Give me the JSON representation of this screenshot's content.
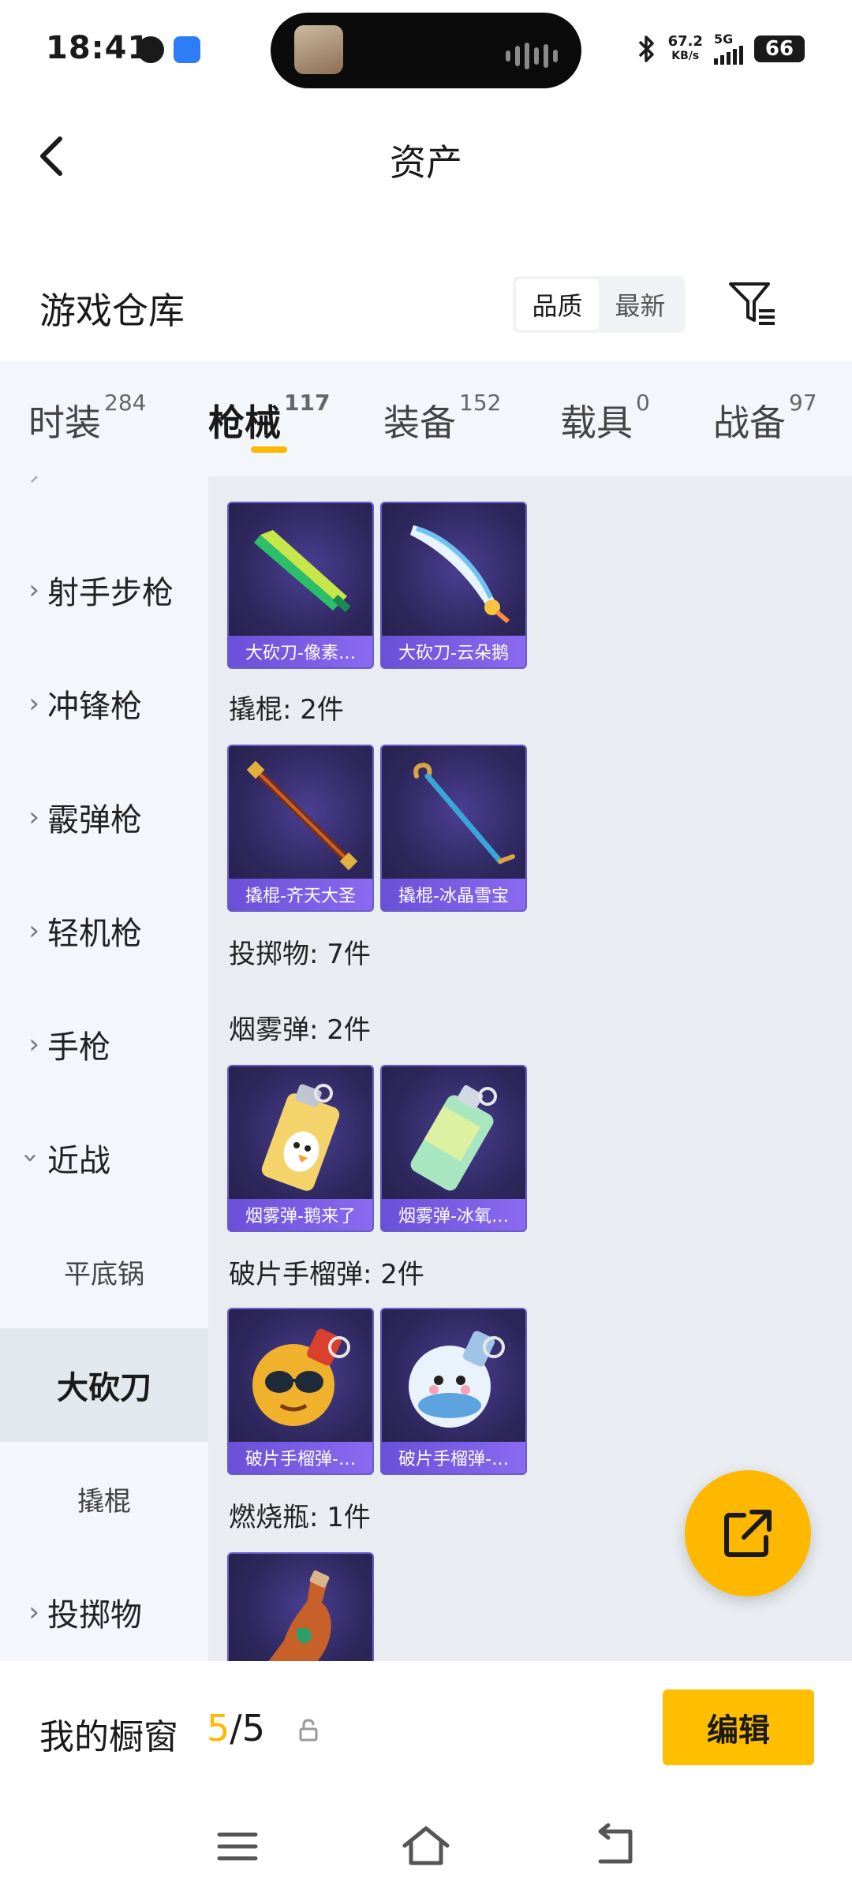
{
  "status_bar": {
    "time": "18:41",
    "net_speed_value": "67.2",
    "net_speed_unit": "KB/s",
    "network": "5G",
    "battery": "66"
  },
  "header": {
    "title": "资产"
  },
  "warehouse": {
    "title": "游戏仓库",
    "sort_options": [
      "品质",
      "最新"
    ],
    "active_sort": "品质"
  },
  "tabs": [
    {
      "label": "时装",
      "count": "284"
    },
    {
      "label": "枪械",
      "count": "117",
      "active": true
    },
    {
      "label": "装备",
      "count": "152"
    },
    {
      "label": "载具",
      "count": "0"
    },
    {
      "label": "战备",
      "count": "97"
    }
  ],
  "sidebar": {
    "items": [
      {
        "label": "射手步枪",
        "expanded": false
      },
      {
        "label": "冲锋枪",
        "expanded": false
      },
      {
        "label": "霰弹枪",
        "expanded": false
      },
      {
        "label": "轻机枪",
        "expanded": false
      },
      {
        "label": "手枪",
        "expanded": false
      },
      {
        "label": "近战",
        "expanded": true
      },
      {
        "label": "平底锅",
        "sub": true
      },
      {
        "label": "大砍刀",
        "sub": true,
        "selected": true
      },
      {
        "label": "撬棍",
        "sub": true
      },
      {
        "label": "投掷物",
        "expanded": false
      }
    ]
  },
  "content": {
    "groups": [
      {
        "label": "撬棍: 2件"
      },
      {
        "label": "投掷物: 7件"
      },
      {
        "label": "烟雾弹: 2件"
      },
      {
        "label": "破片手榴弹: 2件"
      },
      {
        "label": "燃烧瓶: 1件"
      }
    ],
    "items": [
      {
        "name": "大砍刀-像素…",
        "icon": "machete-pixel-icon"
      },
      {
        "name": "大砍刀-云朵鹅",
        "icon": "machete-cloud-goose-icon"
      },
      {
        "name": "撬棍-齐天大圣",
        "icon": "crowbar-monkey-king-icon"
      },
      {
        "name": "撬棍-冰晶雪宝",
        "icon": "crowbar-ice-crystal-icon"
      },
      {
        "name": "烟雾弹-鹅来了",
        "icon": "smoke-goose-icon"
      },
      {
        "name": "烟雾弹-冰氧…",
        "icon": "smoke-ice-icon"
      },
      {
        "name": "破片手榴弹-…",
        "icon": "frag-grenade-sunglasses-icon"
      },
      {
        "name": "破片手榴弹-…",
        "icon": "frag-grenade-snowman-icon"
      },
      {
        "name": "",
        "icon": "molotov-icon"
      }
    ]
  },
  "showcase": {
    "label": "我的橱窗",
    "current": "5",
    "separator": "/",
    "max": "5",
    "edit_label": "编辑"
  },
  "colors": {
    "accent": "#ffb800",
    "item_bg": "#2e275c",
    "item_label_bg": "#7a5ce8"
  }
}
